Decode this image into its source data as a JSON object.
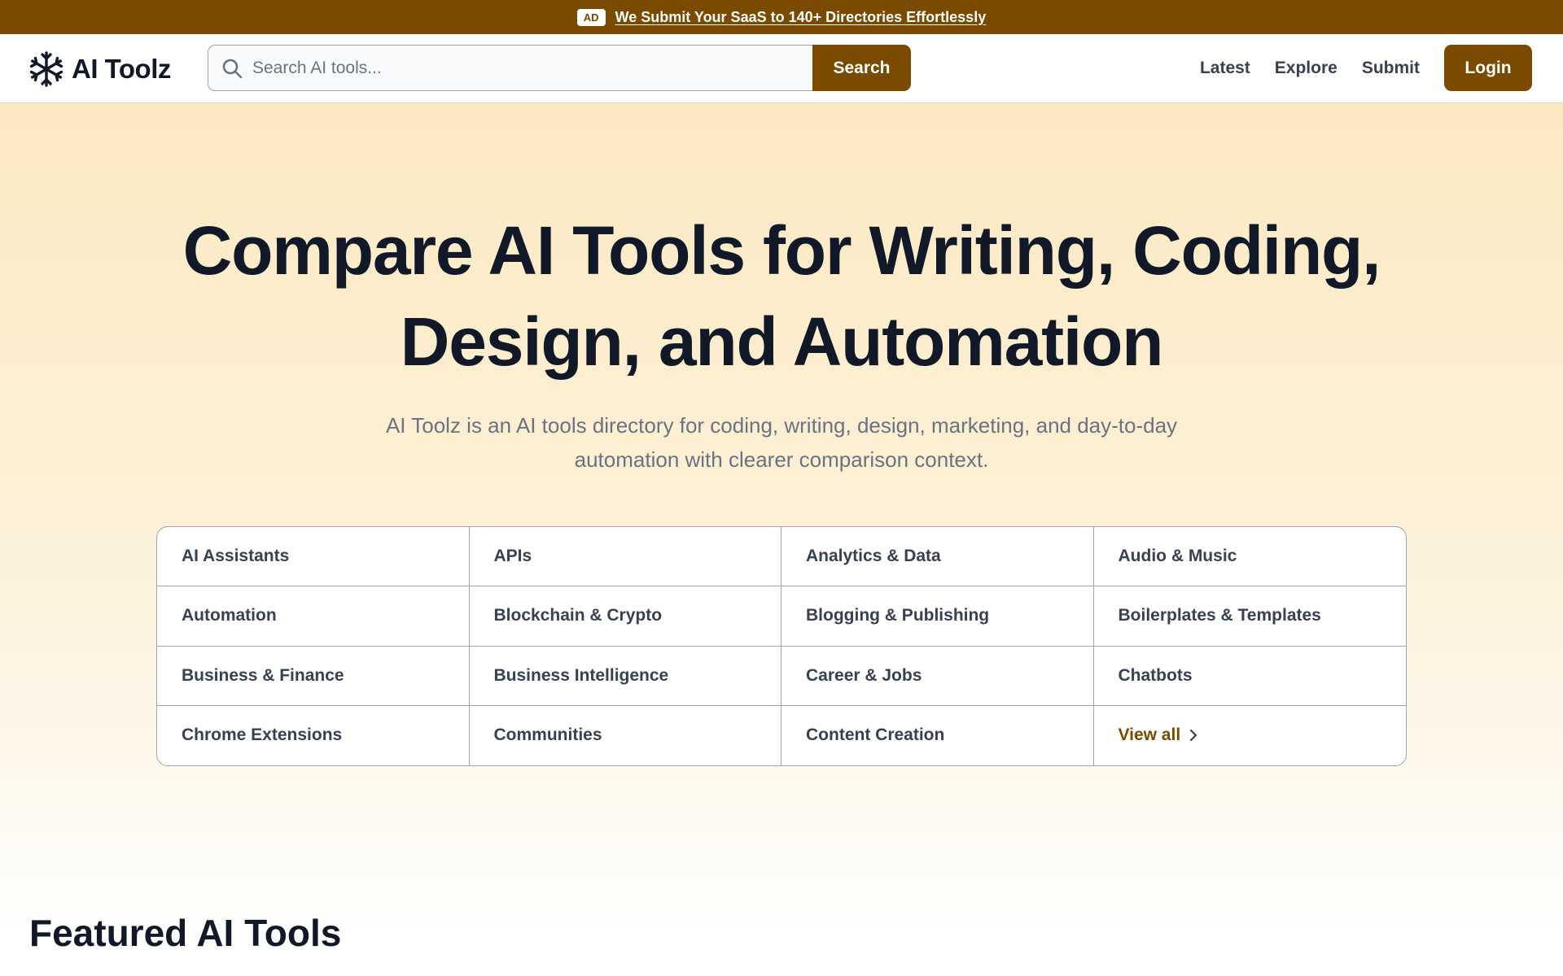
{
  "ad": {
    "badge": "AD",
    "text": "We Submit Your SaaS to 140+ Directories Effortlessly"
  },
  "header": {
    "logo_text": "AI Toolz",
    "logo_icon": "snowflake-icon",
    "search_placeholder": "Search AI tools...",
    "search_button": "Search",
    "nav": [
      "Latest",
      "Explore",
      "Submit"
    ],
    "login": "Login"
  },
  "hero": {
    "title_line1": "Compare AI Tools for Writing, Coding,",
    "title_line2": "Design, and Automation",
    "subtitle": "AI Toolz is an AI tools directory for coding, writing, design, marketing, and day-to-day automation with clearer comparison context."
  },
  "categories": [
    "AI Assistants",
    "APIs",
    "Analytics & Data",
    "Audio & Music",
    "Automation",
    "Blockchain & Crypto",
    "Blogging & Publishing",
    "Boilerplates & Templates",
    "Business & Finance",
    "Business Intelligence",
    "Career & Jobs",
    "Chatbots",
    "Chrome Extensions",
    "Communities",
    "Content Creation"
  ],
  "view_all": "View all",
  "featured": {
    "title": "Featured AI Tools"
  },
  "colors": {
    "brand": "#7a4a00",
    "text": "#111827",
    "muted": "#6b7280"
  }
}
